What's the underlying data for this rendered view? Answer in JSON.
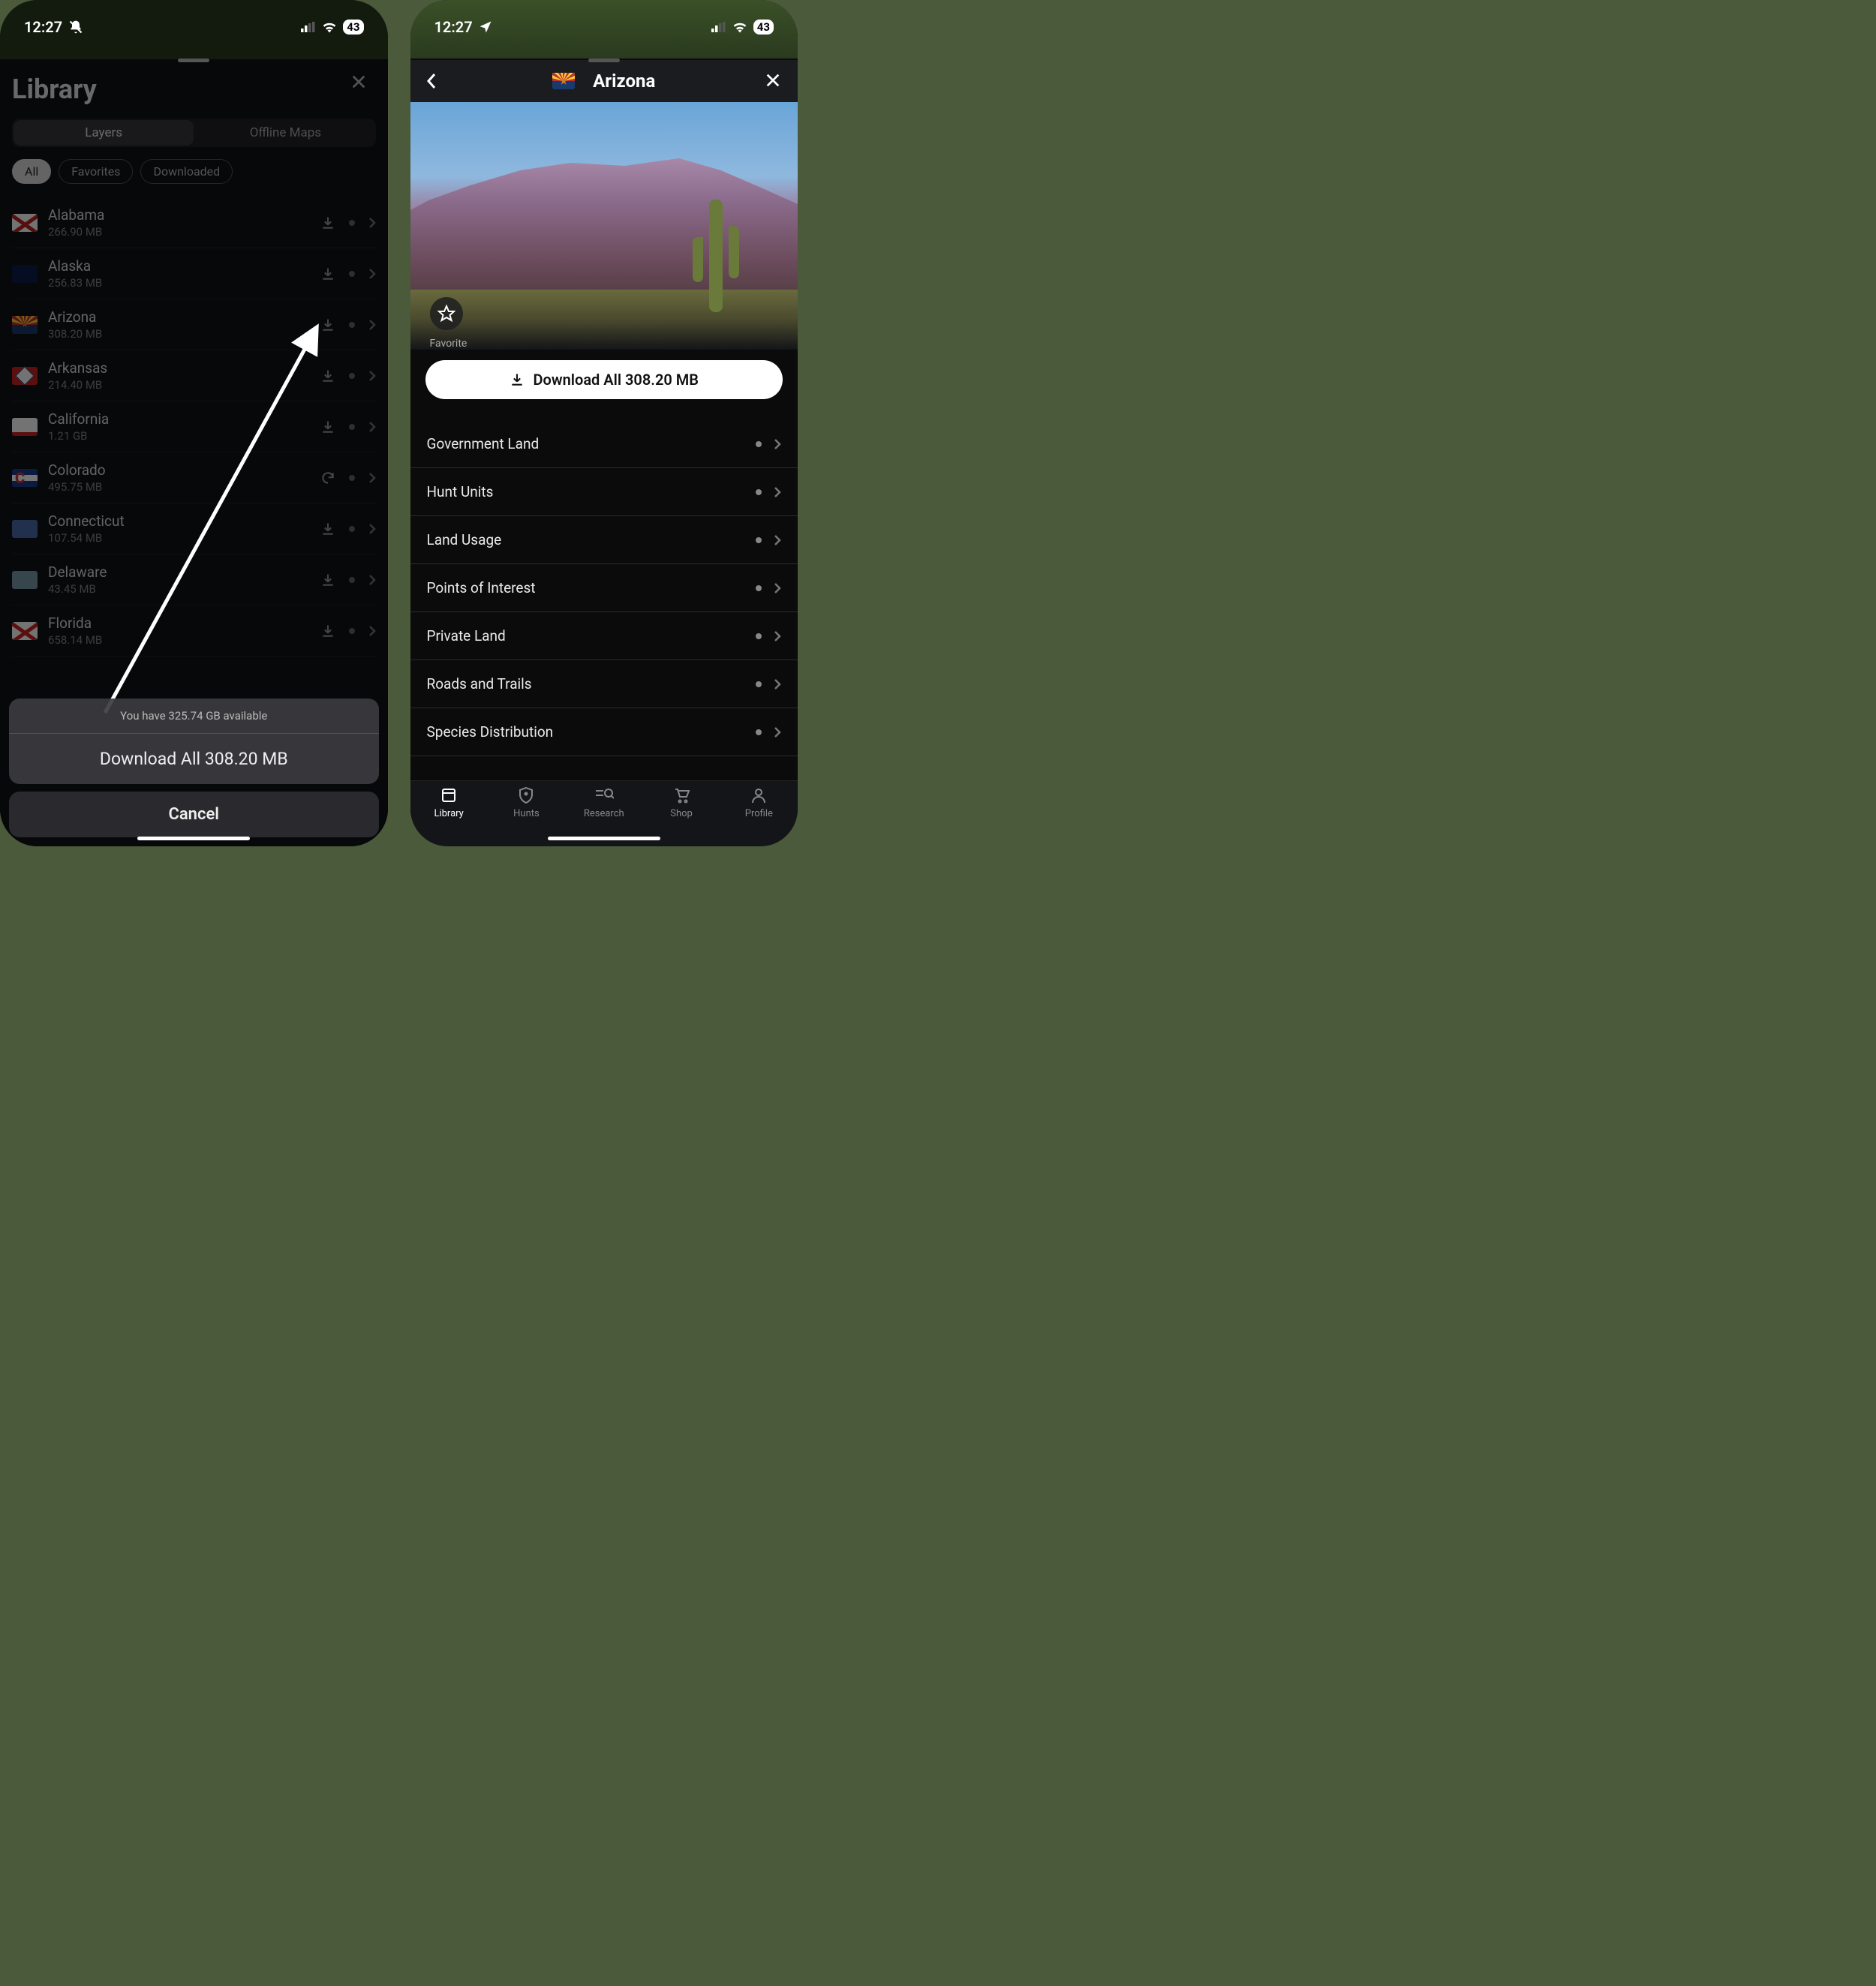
{
  "status": {
    "time": "12:27",
    "battery": "43"
  },
  "left": {
    "title": "Library",
    "tabs": {
      "layers": "Layers",
      "offline": "Offline Maps"
    },
    "filters": {
      "all": "All",
      "favorites": "Favorites",
      "downloaded": "Downloaded"
    },
    "states": [
      {
        "name": "Alabama",
        "size": "266.90 MB",
        "icon": "download"
      },
      {
        "name": "Alaska",
        "size": "256.83 MB",
        "icon": "download"
      },
      {
        "name": "Arizona",
        "size": "308.20 MB",
        "icon": "download"
      },
      {
        "name": "Arkansas",
        "size": "214.40 MB",
        "icon": "download"
      },
      {
        "name": "California",
        "size": "1.21 GB",
        "icon": "download"
      },
      {
        "name": "Colorado",
        "size": "495.75 MB",
        "icon": "refresh"
      },
      {
        "name": "Connecticut",
        "size": "107.54 MB",
        "icon": "download"
      },
      {
        "name": "Delaware",
        "size": "43.45 MB",
        "icon": "download"
      },
      {
        "name": "Florida",
        "size": "658.14 MB",
        "icon": "download"
      }
    ],
    "sheet": {
      "available": "You have 325.74 GB available",
      "download_all": "Download All 308.20 MB",
      "cancel": "Cancel"
    }
  },
  "right": {
    "title": "Arizona",
    "favorite_label": "Favorite",
    "download_all": "Download All 308.20 MB",
    "categories": [
      "Government Land",
      "Hunt Units",
      "Land Usage",
      "Points of Interest",
      "Private Land",
      "Roads and Trails",
      "Species Distribution"
    ],
    "tabs": {
      "library": "Library",
      "hunts": "Hunts",
      "research": "Research",
      "shop": "Shop",
      "profile": "Profile"
    }
  }
}
